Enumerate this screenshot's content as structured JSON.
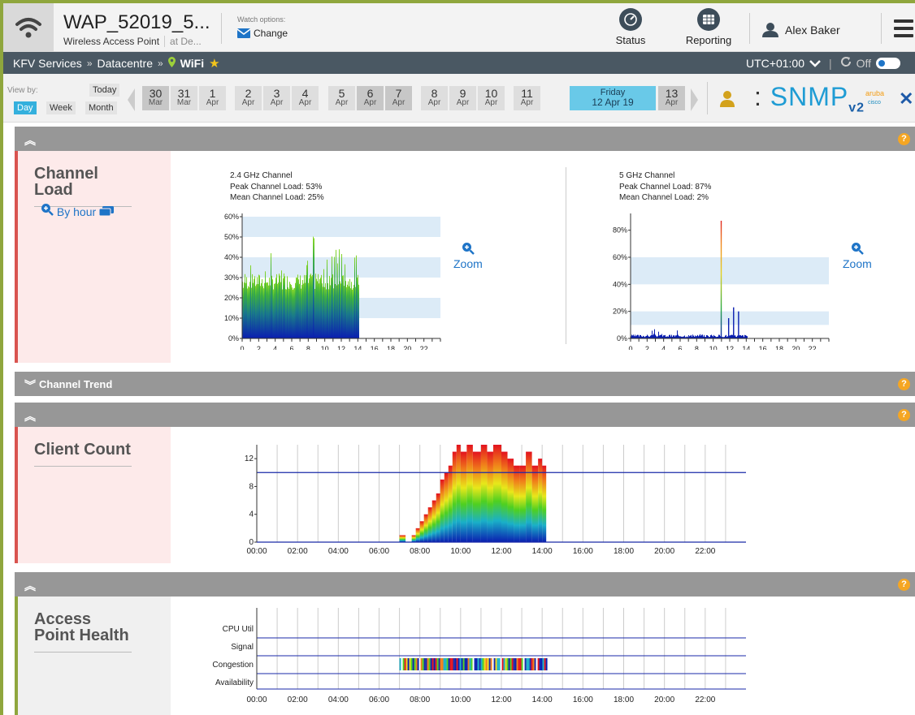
{
  "device": {
    "title": "WAP_52019_5...",
    "type": "Wireless Access Point",
    "location": "at De...",
    "watch_label": "Watch options:",
    "watch_change": "Change"
  },
  "toolbar": {
    "status_label": "Status",
    "reporting_label": "Reporting",
    "user_name": "Alex Baker"
  },
  "breadcrumb": {
    "items": [
      "KFV Services",
      "Datacentre",
      "WiFi"
    ],
    "separator": "»",
    "timezone": "UTC+01:00",
    "refresh_state": "Off"
  },
  "date_nav": {
    "view_by_label": "View by:",
    "today_label": "Today",
    "views": [
      "Day",
      "Week",
      "Month"
    ],
    "selected_view": "Day",
    "days": [
      {
        "n": "30",
        "m": "Mar"
      },
      {
        "n": "31",
        "m": "Mar"
      },
      {
        "n": "1",
        "m": "Apr"
      },
      {
        "n": "2",
        "m": "Apr"
      },
      {
        "n": "3",
        "m": "Apr"
      },
      {
        "n": "4",
        "m": "Apr"
      },
      {
        "n": "5",
        "m": "Apr"
      },
      {
        "n": "6",
        "m": "Apr"
      },
      {
        "n": "7",
        "m": "Apr"
      },
      {
        "n": "8",
        "m": "Apr"
      },
      {
        "n": "9",
        "m": "Apr"
      },
      {
        "n": "10",
        "m": "Apr"
      },
      {
        "n": "11",
        "m": "Apr"
      }
    ],
    "selected_day": {
      "weekday": "Friday",
      "date": "12 Apr 19"
    },
    "next_day": {
      "n": "13",
      "m": "Apr"
    },
    "snmp_label": "SNMP",
    "snmp_version": "v2",
    "vendor_1": "aruba",
    "vendor_2": "cisco"
  },
  "sections": {
    "channel_load": {
      "title": "Channel Load",
      "by_hour": "By hour",
      "zoom": "Zoom"
    },
    "channel_trend": {
      "title": "Channel Trend"
    },
    "client_count": {
      "title": "Client Count"
    },
    "ap_health": {
      "title": "Access Point Health"
    },
    "help": "?"
  },
  "chart_data": [
    {
      "type": "bar",
      "title": "2.4 GHz Channel",
      "subtitle_lines": [
        "Peak Channel Load: 53%",
        "Mean Channel Load: 25%"
      ],
      "x_ticks": [
        "0",
        "2",
        "4",
        "6",
        "8",
        "10",
        "12",
        "14",
        "16",
        "18",
        "20",
        "22"
      ],
      "y_ticks": [
        "0%",
        "10%",
        "20%",
        "30%",
        "40%",
        "50%",
        "60%"
      ],
      "ylim": [
        0,
        60
      ],
      "x_range": [
        0,
        24
      ],
      "data_until_hour": 14.2,
      "peak": 53,
      "mean": 25
    },
    {
      "type": "bar",
      "title": "5 GHz Channel",
      "subtitle_lines": [
        "Peak Channel Load: 87%",
        "Mean Channel Load: 2%"
      ],
      "x_ticks": [
        "0",
        "2",
        "4",
        "6",
        "8",
        "10",
        "12",
        "14",
        "16",
        "18",
        "20",
        "22"
      ],
      "y_ticks": [
        "0%",
        "20%",
        "40%",
        "60%",
        "80%"
      ],
      "ylim": [
        0,
        90
      ],
      "x_range": [
        0,
        24
      ],
      "spikes": [
        {
          "x": 10.9,
          "y": 87
        },
        {
          "x": 11.8,
          "y": 15
        },
        {
          "x": 12.4,
          "y": 23
        },
        {
          "x": 13.0,
          "y": 20
        }
      ],
      "peak": 87,
      "mean": 2
    },
    {
      "type": "bar",
      "title": "",
      "x_ticks": [
        "00:00",
        "02:00",
        "04:00",
        "06:00",
        "08:00",
        "10:00",
        "12:00",
        "14:00",
        "16:00",
        "18:00",
        "20:00",
        "22:00"
      ],
      "y_ticks": [
        "0",
        "4",
        "8",
        "12"
      ],
      "ylim": [
        0,
        14
      ],
      "threshold": 10,
      "points": [
        [
          7.0,
          1
        ],
        [
          7.3,
          0
        ],
        [
          7.6,
          1
        ],
        [
          7.8,
          2
        ],
        [
          8.0,
          3
        ],
        [
          8.2,
          4
        ],
        [
          8.4,
          5
        ],
        [
          8.6,
          6
        ],
        [
          8.8,
          7
        ],
        [
          9.0,
          9
        ],
        [
          9.2,
          10
        ],
        [
          9.4,
          11
        ],
        [
          9.6,
          13
        ],
        [
          9.8,
          14
        ],
        [
          10.0,
          13
        ],
        [
          10.3,
          14
        ],
        [
          10.6,
          13
        ],
        [
          11.0,
          14
        ],
        [
          11.3,
          13
        ],
        [
          11.6,
          14
        ],
        [
          12.0,
          13
        ],
        [
          12.3,
          12
        ],
        [
          12.6,
          11
        ],
        [
          12.9,
          11
        ],
        [
          13.2,
          13
        ],
        [
          13.5,
          11
        ],
        [
          13.8,
          12
        ],
        [
          14.0,
          11
        ]
      ]
    },
    {
      "type": "heatmap",
      "title": "",
      "rows": [
        "CPU Util",
        "Signal",
        "Congestion",
        "Availability"
      ],
      "x_ticks": [
        "00:00",
        "02:00",
        "04:00",
        "06:00",
        "08:00",
        "10:00",
        "12:00",
        "14:00",
        "16:00",
        "18:00",
        "20:00",
        "22:00"
      ],
      "congestion_span": [
        7.0,
        14.2
      ]
    }
  ]
}
